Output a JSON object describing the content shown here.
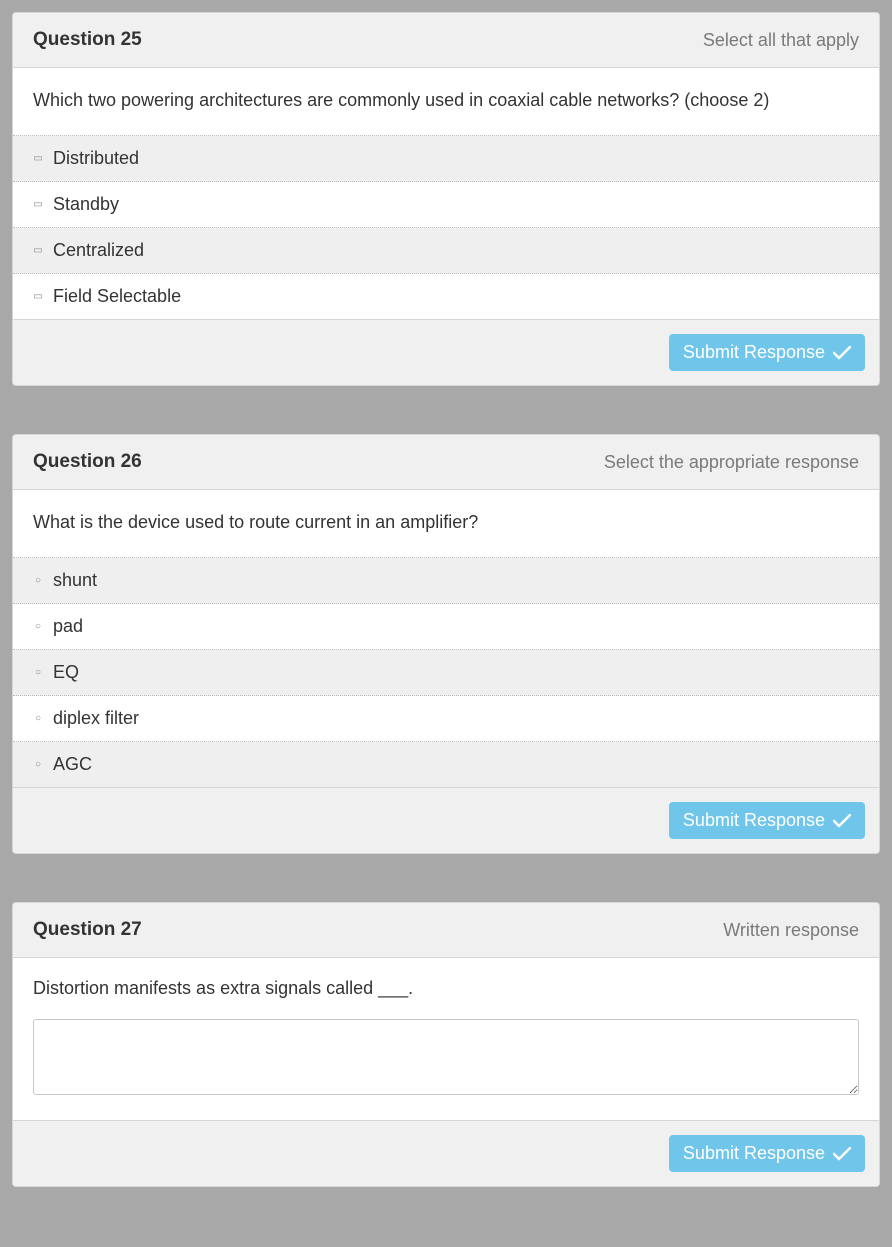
{
  "submit_label": "Submit Response",
  "questions": [
    {
      "number": "Question 25",
      "type_label": "Select all that apply",
      "prompt": "Which two powering architectures are commonly used in coaxial cable networks? (choose 2)",
      "kind": "checkbox",
      "options": [
        "Distributed",
        "Standby",
        "Centralized",
        "Field Selectable"
      ]
    },
    {
      "number": "Question 26",
      "type_label": "Select the appropriate response",
      "prompt": "What is the device used to route current in an amplifier?",
      "kind": "radio",
      "options": [
        "shunt",
        "pad",
        "EQ",
        "diplex filter",
        "AGC"
      ]
    },
    {
      "number": "Question 27",
      "type_label": "Written response",
      "prompt": "Distortion manifests as extra signals called ___.",
      "kind": "written"
    }
  ]
}
